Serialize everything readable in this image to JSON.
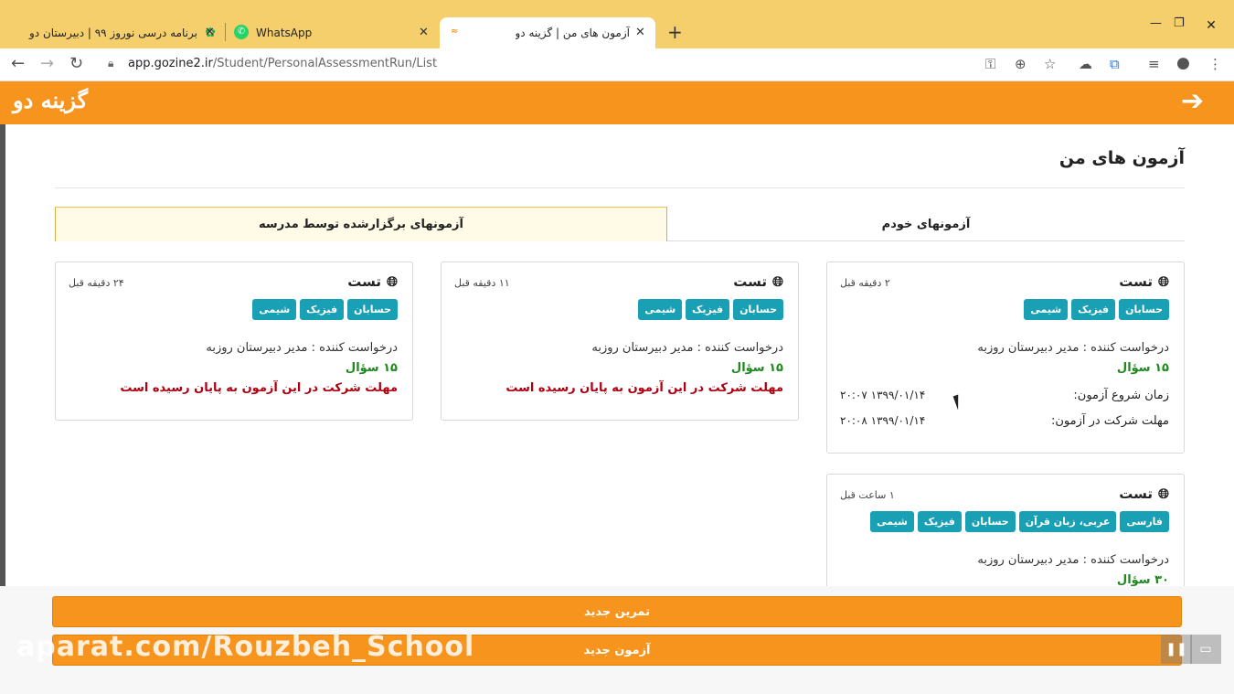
{
  "browser": {
    "tabs": [
      {
        "title": "برنامه درسی نوروز ۹۹ | دبیرستان دو",
        "active": false
      },
      {
        "title": "WhatsApp",
        "active": false
      },
      {
        "title": "آزمون های من | گزینه دو",
        "active": true
      }
    ],
    "close_glyph": "✕",
    "new_tab": "+",
    "url_domain": "app.gozine2.ir",
    "url_path": "/Student/PersonalAssessmentRun/List"
  },
  "app": {
    "logo": "گزینه دو",
    "page_title": "آزمون های من",
    "tabs": [
      {
        "label": "آزمونهای خودم",
        "selected": false
      },
      {
        "label": "آزمونهای برگزارشده توسط مدرسه",
        "selected": true
      }
    ]
  },
  "cards": [
    {
      "title": "تست",
      "ago": "۲ دقیقه قبل",
      "tags": [
        "حسابان",
        "فیزیک",
        "شیمی"
      ],
      "requester": "درخواست کننده : مدیر دبیرستان روزبه",
      "questions": "۱۵ سؤال",
      "start_label": "زمان شروع آزمون:",
      "start_value": "۱۳۹۹/۰۱/۱۴ ۲۰:۰۷",
      "deadline_label": "مهلت شرکت در آزمون:",
      "deadline_value": "۱۳۹۹/۰۱/۱۴ ۲۰:۰۸"
    },
    {
      "title": "تست",
      "ago": "۱۱ دقیقه قبل",
      "tags": [
        "حسابان",
        "فیزیک",
        "شیمی"
      ],
      "requester": "درخواست کننده : مدیر دبیرستان روزبه",
      "questions": "۱۵ سؤال",
      "status": "مهلت شرکت در این آزمون به پایان رسیده است"
    },
    {
      "title": "تست",
      "ago": "۲۴ دقیقه قبل",
      "tags": [
        "حسابان",
        "فیزیک",
        "شیمی"
      ],
      "requester": "درخواست کننده : مدیر دبیرستان روزبه",
      "questions": "۱۵ سؤال",
      "status": "مهلت شرکت در این آزمون به پایان رسیده است"
    },
    {
      "title": "تست",
      "ago": "۱ ساعت قبل",
      "tags": [
        "فارسی",
        "عربی، زبان قرآن",
        "حسابان",
        "فیزیک",
        "شیمی"
      ],
      "requester": "درخواست کننده : مدیر دبیرستان روزبه",
      "questions": "۳۰ سؤال"
    }
  ],
  "buttons": {
    "new_practice": "تمرین جدید",
    "new_exam": "آزمون جدید"
  },
  "watermark": "aparat.com/Rouzbeh_School",
  "colors": {
    "brand": "#f7941d",
    "tag": "#1aa0b5",
    "success": "#1e8a1e",
    "danger": "#b00010",
    "tabstrip": "#f5cf6c"
  }
}
